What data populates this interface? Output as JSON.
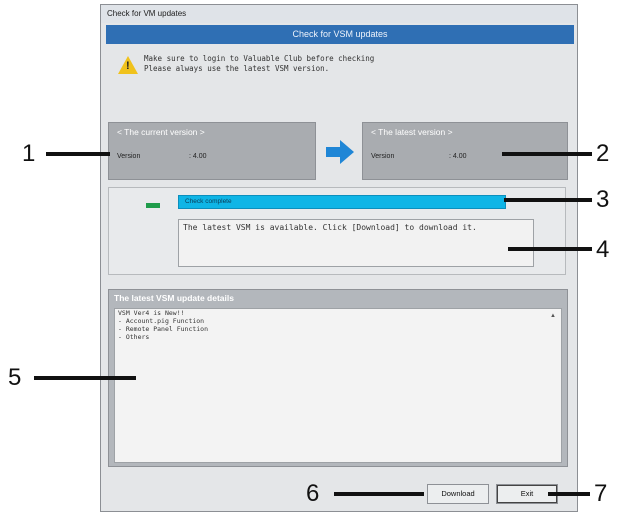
{
  "window": {
    "title": "Check for VM updates",
    "banner": "Check for VSM updates",
    "notice_lines": [
      "Make sure to login to Valuable Club before checking",
      "Please always use the latest VSM version."
    ]
  },
  "current": {
    "heading": "< The current version >",
    "label": "Version",
    "value": ": 4.00"
  },
  "latest": {
    "heading": "< The latest version >",
    "label": "Version",
    "value": ": 4.00"
  },
  "status": {
    "progress_text": "Check complete",
    "progress_fraction": 1.0,
    "message": "The latest VSM is available. Click [Download] to download it."
  },
  "details": {
    "title": "The latest VSM update details",
    "lines": [
      "VSM Ver4 is New!!",
      "- Account.pig Function",
      "- Remote Panel Function",
      "- Others"
    ]
  },
  "buttons": {
    "download": "Download",
    "exit": "Exit"
  },
  "callouts": [
    "1",
    "2",
    "3",
    "4",
    "5",
    "6",
    "7"
  ],
  "colors": {
    "banner": "#2f6fb4",
    "progress": "#0fb5e6",
    "led": "#1f9c4b",
    "arrow": "#1f86d6",
    "warning": "#f0c21c"
  },
  "icons": [
    "warning-icon",
    "arrow-right-icon",
    "status-led-icon"
  ]
}
